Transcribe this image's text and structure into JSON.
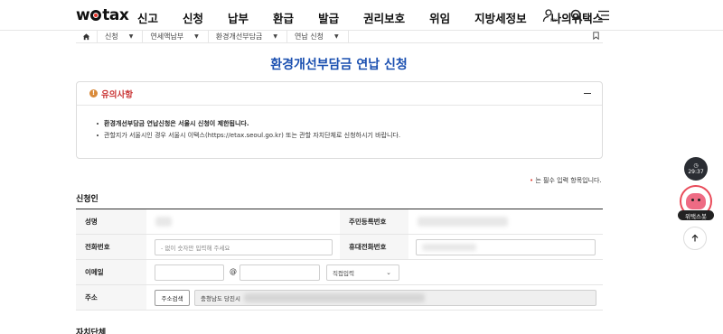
{
  "header": {
    "logo": "wetax",
    "menu": [
      "신고",
      "신청",
      "납부",
      "환급",
      "발급",
      "권리보호",
      "위임",
      "지방세정보",
      "나의위택스"
    ]
  },
  "breadcrumb": [
    "신청",
    "연세액납부",
    "환경개선부담금",
    "연납 신청"
  ],
  "page_title": "환경개선부담금 연납 신청",
  "notice": {
    "title": "유의사항",
    "items": [
      "환경개선부담금 연납신청은 서울시 신청이 제한됩니다.",
      "관할지가 서울시인 경우 서울시 이택스(https://etax.seoul.go.kr) 또는 관할 자치단체로 신청하시기 바랍니다."
    ]
  },
  "required_note": "는 필수 입력 항목입니다.",
  "applicant": {
    "section_title": "신청인",
    "name_label": "성명",
    "rrn_label": "주민등록번호",
    "phone_label": "전화번호",
    "phone_placeholder": "- 없이 숫자만 입력해 주세요",
    "mobile_label": "휴대전화번호",
    "email_label": "이메일",
    "email_at": "@",
    "email_domain_select": "직접입력",
    "address_label": "주소",
    "address_search_button": "주소검색",
    "address_value": "충청남도 당진시"
  },
  "next_section_title": "자치단체",
  "side": {
    "time": "29:37",
    "chatbot_label": "위택스봇"
  }
}
